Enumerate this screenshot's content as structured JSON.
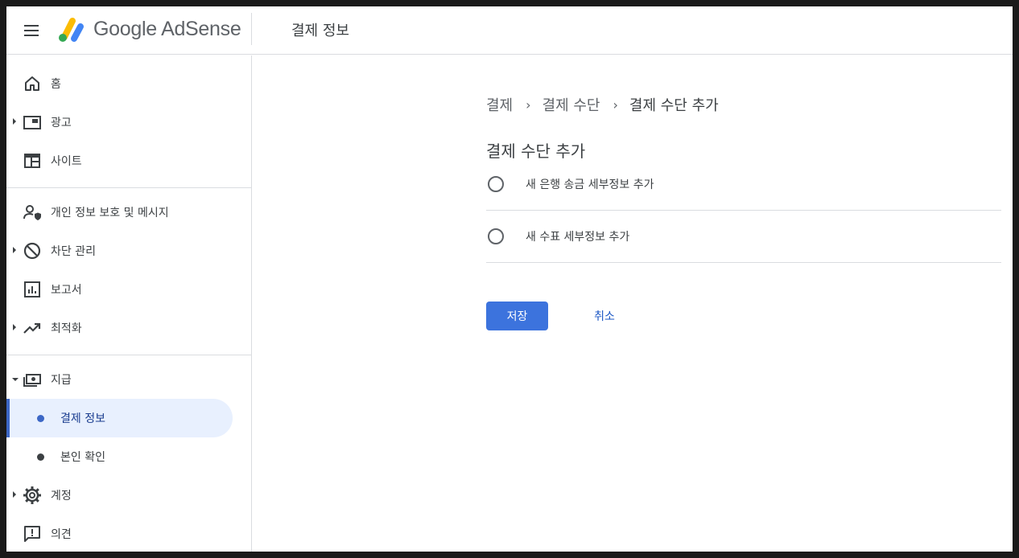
{
  "header": {
    "brand": "Google AdSense",
    "title": "결제 정보",
    "menu_icon": "hamburger-menu-icon",
    "logo_colors": [
      "#fbbc04",
      "#34a853",
      "#4285f4"
    ]
  },
  "sidebar": {
    "items": [
      {
        "label": "홈",
        "icon": "home-icon",
        "has_caret": false
      },
      {
        "label": "광고",
        "icon": "ads-icon",
        "has_caret": true
      },
      {
        "label": "사이트",
        "icon": "sites-icon",
        "has_caret": false
      },
      {
        "label": "개인 정보 보호 및 메시지",
        "icon": "privacy-messaging-icon",
        "has_caret": false
      },
      {
        "label": "차단 관리",
        "icon": "block-icon",
        "has_caret": true
      },
      {
        "label": "보고서",
        "icon": "reports-icon",
        "has_caret": false
      },
      {
        "label": "최적화",
        "icon": "optimization-trend-icon",
        "has_caret": true
      },
      {
        "label": "지급",
        "icon": "payments-icon",
        "has_caret": true,
        "expanded": true
      },
      {
        "label": "계정",
        "icon": "gear-icon",
        "has_caret": true
      },
      {
        "label": "의견",
        "icon": "feedback-icon",
        "has_caret": false
      }
    ],
    "payment_subitems": [
      {
        "label": "결제 정보",
        "active": true
      },
      {
        "label": "본인 확인",
        "active": false
      }
    ]
  },
  "main": {
    "breadcrumb": [
      "결제",
      "결제 수단",
      "결제 수단 추가"
    ],
    "breadcrumb_separator": "›",
    "page_title": "결제 수단 추가",
    "options": [
      {
        "label": "새 은행 송금 세부정보 추가",
        "selected": false
      },
      {
        "label": "새 수표 세부정보 추가",
        "selected": false
      }
    ],
    "save_label": "저장",
    "cancel_label": "취소"
  },
  "colors": {
    "accent": "#3c73dd",
    "active_nav_bg": "#e8f0fe",
    "link": "#1a56c4"
  }
}
